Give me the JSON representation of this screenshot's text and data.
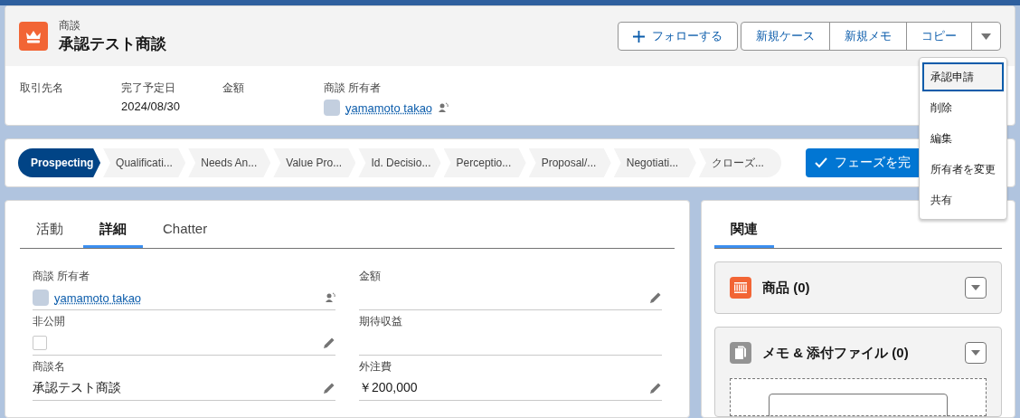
{
  "header": {
    "object_label": "商談",
    "title": "承認テスト商談",
    "actions": [
      {
        "label": "フォローする",
        "kind": "follow"
      },
      {
        "label": "新規ケース",
        "kind": "group"
      },
      {
        "label": "新規メモ",
        "kind": "group"
      },
      {
        "label": "コピー",
        "kind": "group"
      }
    ],
    "fields": [
      {
        "label": "取引先名",
        "kind": "text"
      },
      {
        "label": "完了予定日",
        "value": "2024/08/30",
        "kind": "text"
      },
      {
        "label": "金額",
        "kind": "text"
      },
      {
        "label": "商談 所有者",
        "value": "yamamoto takao",
        "kind": "user"
      }
    ]
  },
  "menu": [
    {
      "label": "承認申請",
      "selected": true
    },
    {
      "label": "削除",
      "selected": false
    },
    {
      "label": "編集",
      "selected": false
    },
    {
      "label": "所有者を変更",
      "selected": false
    },
    {
      "label": "共有",
      "selected": false
    }
  ],
  "path": {
    "stages": [
      {
        "label": "Prospecting",
        "selected": true
      },
      {
        "label": "Qualificati...",
        "selected": false
      },
      {
        "label": "Needs An...",
        "selected": false
      },
      {
        "label": "Value Pro...",
        "selected": false
      },
      {
        "label": "Id. Decisio...",
        "selected": false
      },
      {
        "label": "Perceptio...",
        "selected": false
      },
      {
        "label": "Proposal/...",
        "selected": false
      },
      {
        "label": "Negotiati...",
        "selected": false
      },
      {
        "label": "クローズ...",
        "selected": false
      }
    ],
    "complete_button": "フェーズを完"
  },
  "tabs": [
    {
      "label": "活動",
      "selected": false
    },
    {
      "label": "詳細",
      "selected": true
    },
    {
      "label": "Chatter",
      "selected": false
    }
  ],
  "details": [
    {
      "label": "商談 所有者",
      "value": "yamamoto takao",
      "kind": "user",
      "editable": false
    },
    {
      "label": "金額",
      "kind": "text",
      "editable": true
    },
    {
      "label": "非公開",
      "kind": "checkbox",
      "checked": false,
      "editable": true
    },
    {
      "label": "期待収益",
      "kind": "text",
      "editable": false
    },
    {
      "label": "商談名",
      "value": "承認テスト商談",
      "kind": "text",
      "editable": true
    },
    {
      "label": "外注費",
      "value": "￥200,000",
      "kind": "text",
      "editable": true
    }
  ],
  "related": {
    "tab": {
      "label": "関連",
      "selected": true
    },
    "cards": [
      {
        "title": "商品 (0)",
        "color": "#f26535",
        "kind": "products"
      },
      {
        "title": "メモ & 添付ファイル (0)",
        "color": "#939393",
        "kind": "files"
      }
    ]
  }
}
